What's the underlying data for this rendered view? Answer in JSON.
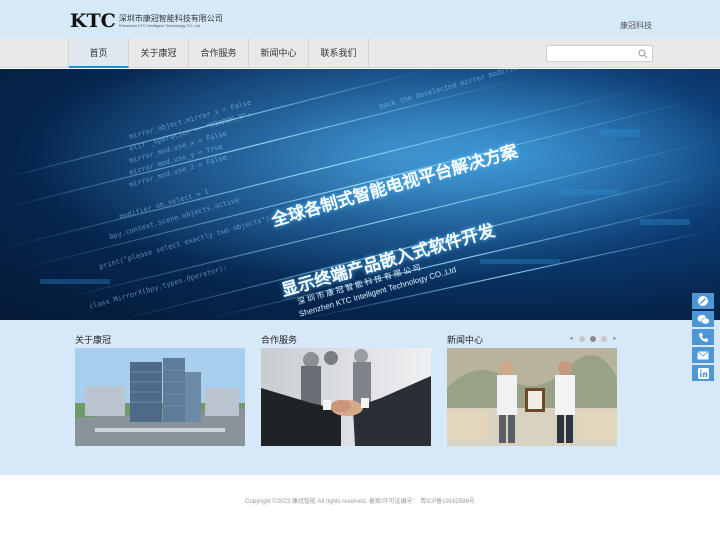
{
  "header": {
    "logo_mark": "KTC",
    "logo_cn": "深圳市康冠智能科技有限公司",
    "logo_en": "Shenzhen KTC Intelligent Technology CO.,Ltd",
    "right_text": "康冠科技"
  },
  "nav": {
    "items": [
      {
        "label": "首页"
      },
      {
        "label": "关于康冠"
      },
      {
        "label": "合作服务"
      },
      {
        "label": "新闻中心"
      },
      {
        "label": "联系我们"
      }
    ],
    "active_index": 0
  },
  "search": {
    "value": "",
    "placeholder": ""
  },
  "banner": {
    "line1": "全球各制式智能电视平台解决方案",
    "line2": "显示终端产品嵌入式软件开发",
    "company_cn": "深圳市康冠智能科技有限公司",
    "company_en": "Shenzhen KTC Intelligent Technology CO.,Ltd",
    "slides": 2,
    "current_slide": 1
  },
  "sections": [
    {
      "title": "关于康冠",
      "image": "office-buildings-aerial"
    },
    {
      "title": "合作服务",
      "image": "business-handshake"
    },
    {
      "title": "新闻中心",
      "image": "award-ceremony"
    }
  ],
  "news_pager": {
    "prev": "◄",
    "next": "►",
    "dots": 3,
    "current": 1
  },
  "footer": {
    "copyright": "Copyright ©2023 康冠智能  All rights reserved. 备案/许可证编号：  粤ICP备19162586号"
  },
  "side_bar": [
    "edit-icon",
    "wechat-icon",
    "phone-icon",
    "mail-icon",
    "linkedin-icon"
  ],
  "colors": {
    "accent": "#1d8fd3",
    "header_bg": "#d6e9f7",
    "content_bg": "#d7e9f8",
    "side_btn": "#4d97d6"
  }
}
